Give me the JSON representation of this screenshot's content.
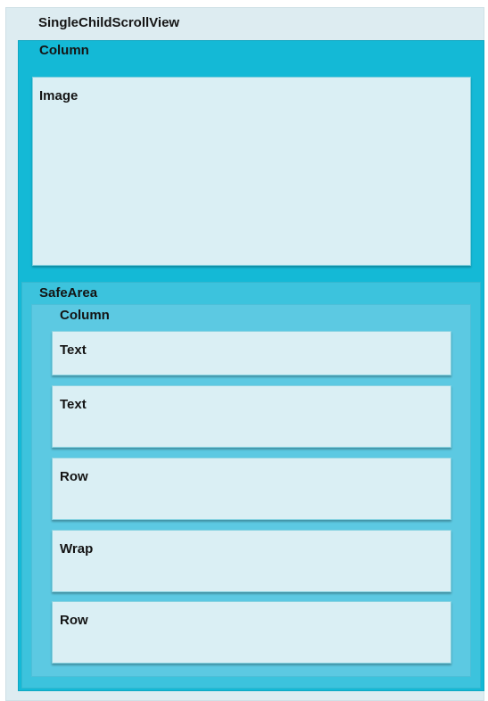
{
  "diagram": {
    "title_node": "SingleChildScrollView",
    "outer_column": "Column",
    "image": "Image",
    "safe_area": "SafeArea",
    "inner_column": "Column",
    "children": [
      "Text",
      "Text",
      "Row",
      "Wrap",
      "Row"
    ]
  },
  "colors": {
    "scroll_view_bg": "#ddecf1",
    "column_bg": "#14b9d6",
    "safe_area_bg": "#3cc3dd",
    "inner_column_bg": "#5cc9e2",
    "widget_bg": "#daeff4"
  }
}
